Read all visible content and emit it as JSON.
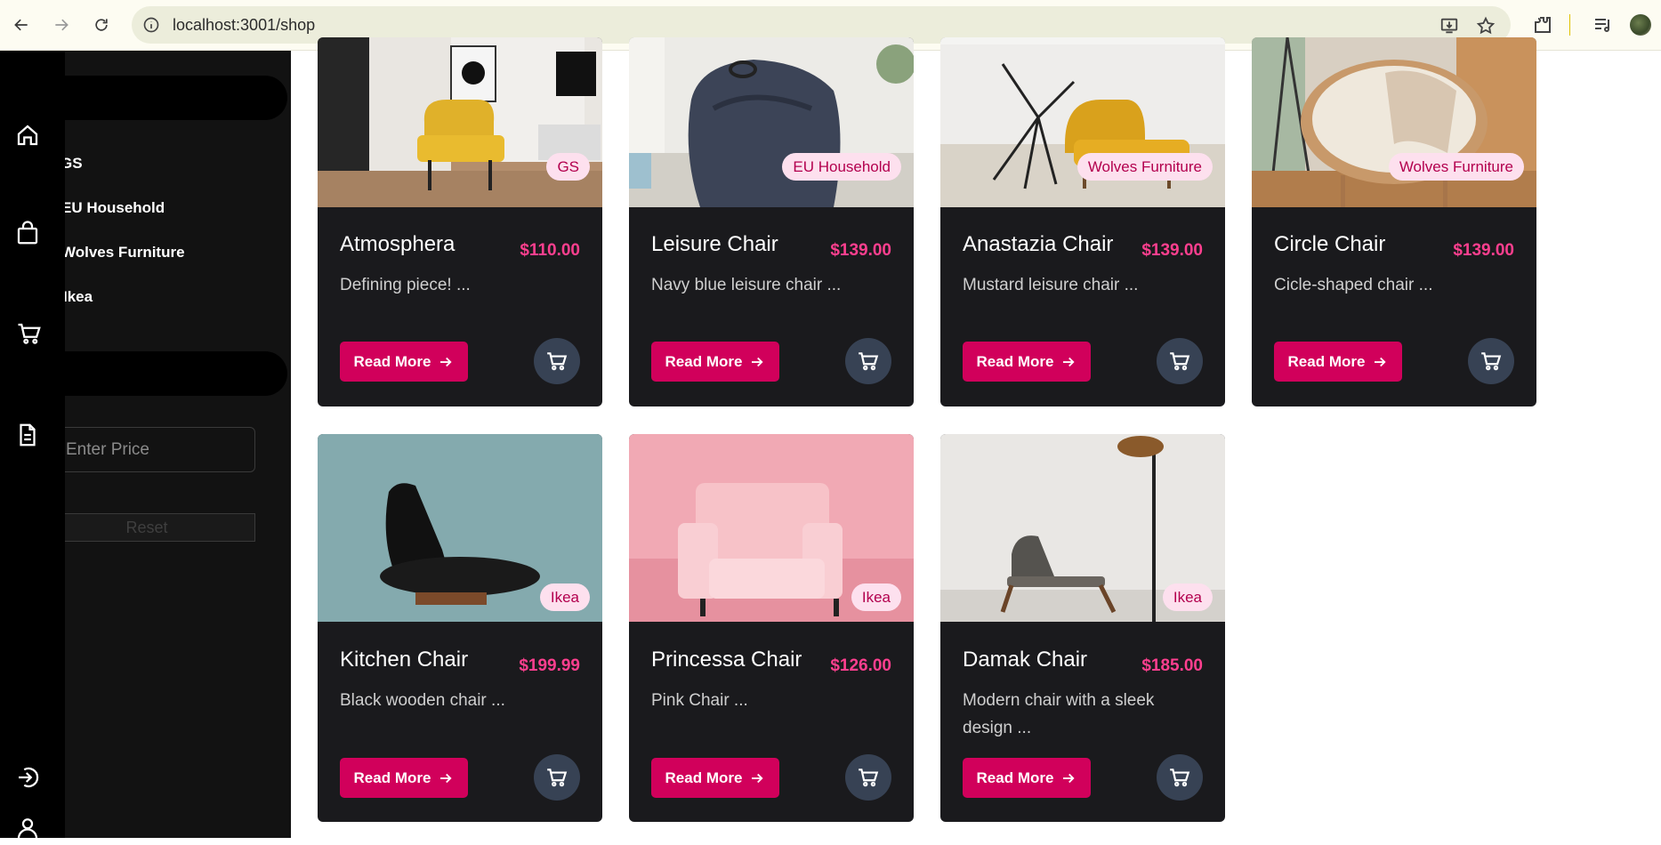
{
  "browser": {
    "url": "localhost:3001/shop"
  },
  "rail": {
    "icons": [
      "home-icon",
      "shopping-bag-icon",
      "cart-icon",
      "document-icon",
      "logout-icon",
      "user-icon"
    ]
  },
  "filters": {
    "brands": [
      "GS",
      "EU Household",
      "Wolves Furniture",
      "Ikea"
    ],
    "price_placeholder": "Enter Price",
    "reset_label": "Reset"
  },
  "products": [
    {
      "title": "Atmosphera",
      "price": "$110.00",
      "desc": "Defining piece! ...",
      "brand": "GS",
      "read_more": "Read More"
    },
    {
      "title": "Leisure Chair",
      "price": "$139.00",
      "desc": "Navy blue leisure chair ...",
      "brand": "EU Household",
      "read_more": "Read More"
    },
    {
      "title": "Anastazia Chair",
      "price": "$139.00",
      "desc": "Mustard leisure chair ...",
      "brand": "Wolves Furniture",
      "read_more": "Read More"
    },
    {
      "title": "Circle Chair",
      "price": "$139.00",
      "desc": "Cicle-shaped chair ...",
      "brand": "Wolves Furniture",
      "read_more": "Read More"
    },
    {
      "title": "Kitchen Chair",
      "price": "$199.99",
      "desc": "Black wooden chair ...",
      "brand": "Ikea",
      "read_more": "Read More"
    },
    {
      "title": "Princessa Chair",
      "price": "$126.00",
      "desc": "Pink Chair ...",
      "brand": "Ikea",
      "read_more": "Read More"
    },
    {
      "title": "Damak Chair",
      "price": "$185.00",
      "desc": "Modern chair with a sleek design ...",
      "brand": "Ikea",
      "read_more": "Read More"
    }
  ],
  "colors": {
    "accent": "#d1005b",
    "price": "#ff3f8f",
    "card_bg": "#1a1a1d",
    "cart_btn": "#374254"
  }
}
